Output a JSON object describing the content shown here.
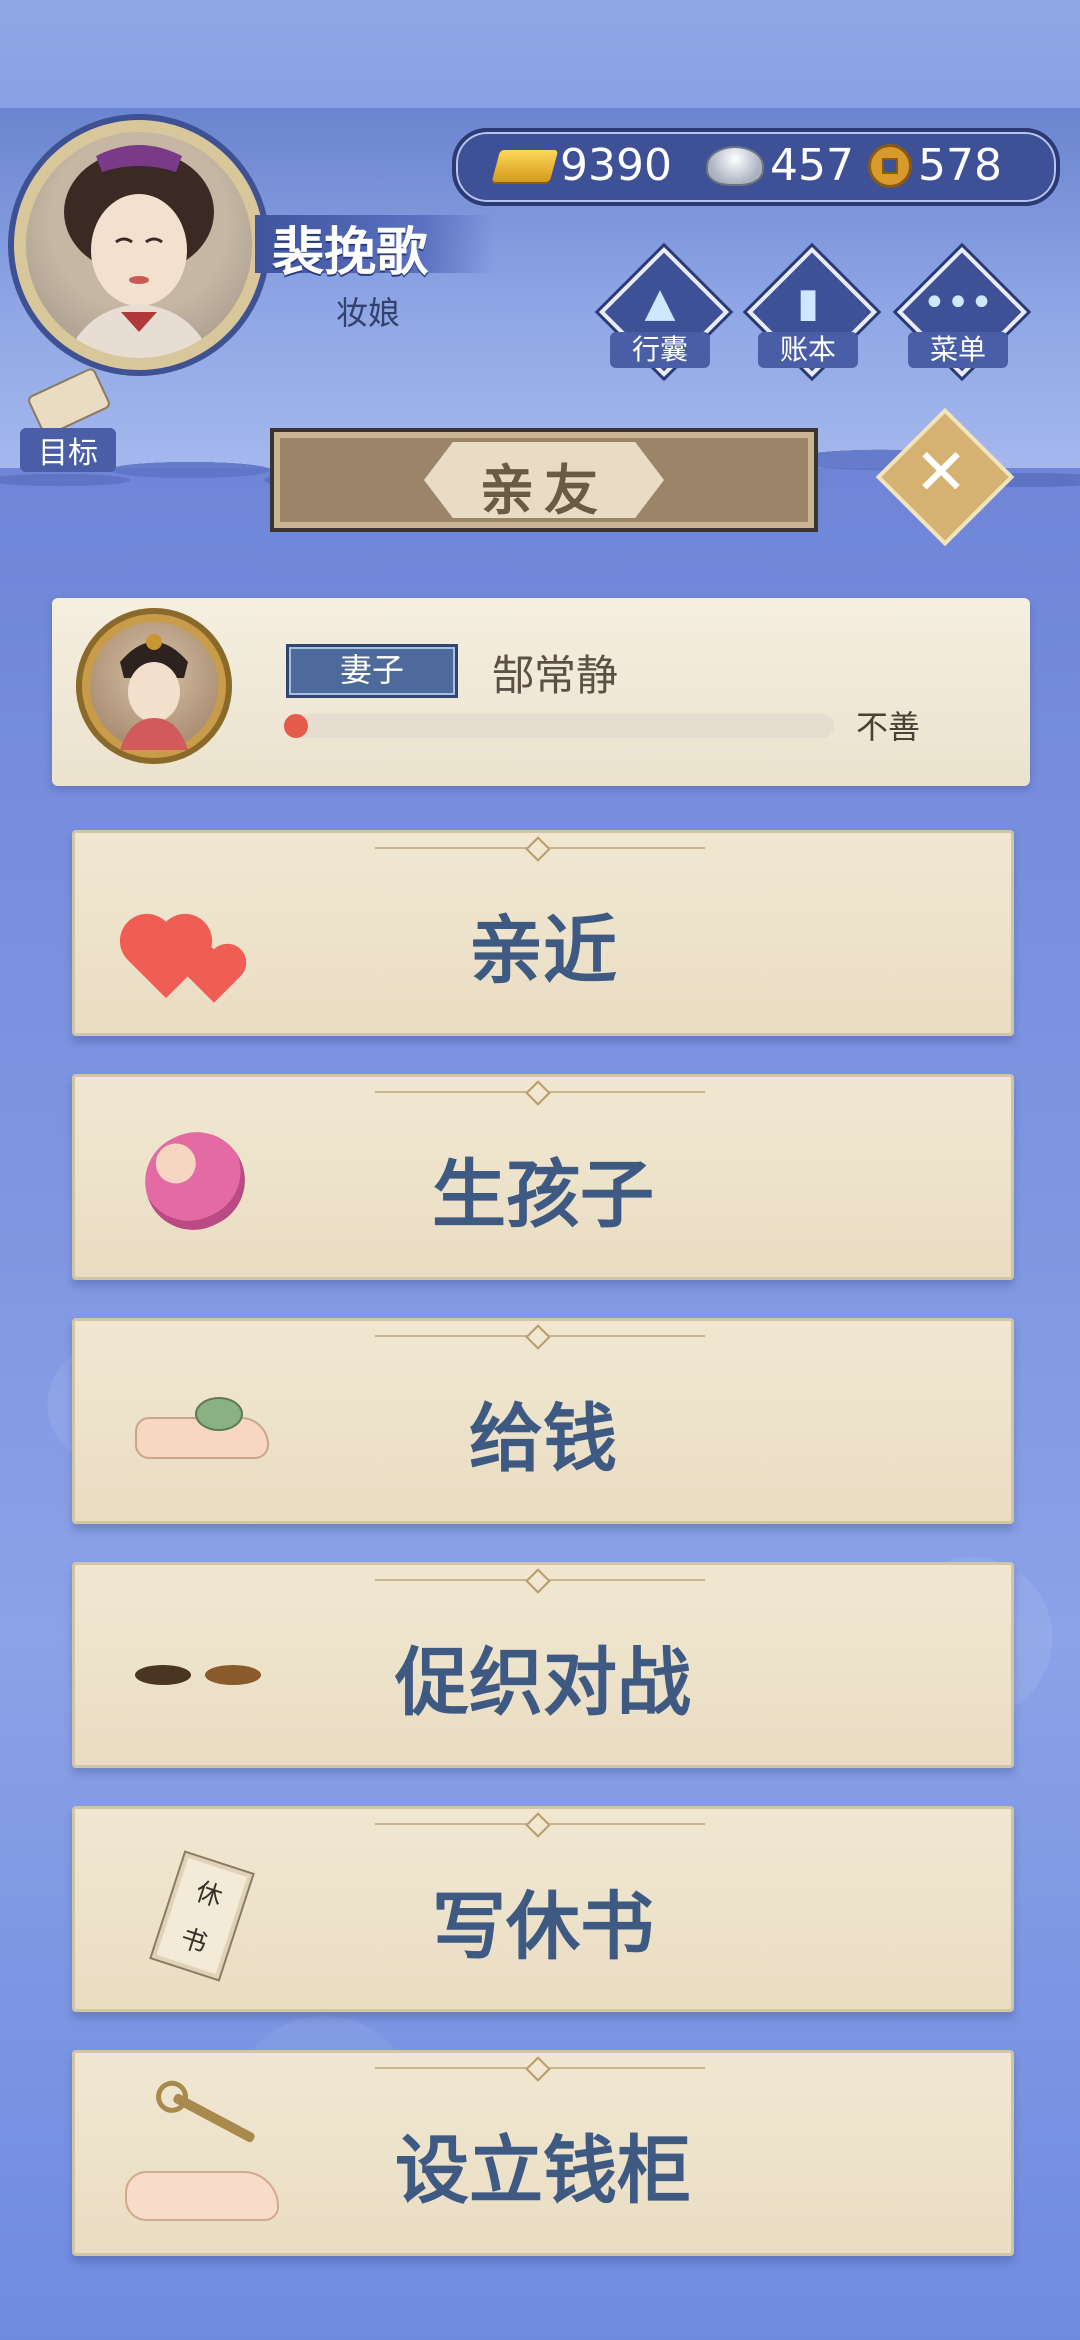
{
  "player": {
    "name": "裴挽歌",
    "title": "妆娘"
  },
  "currency": {
    "gold": "9390",
    "silver": "457",
    "copper": "578"
  },
  "menu": {
    "bag": "行囊",
    "ledger": "账本",
    "more": "菜单"
  },
  "goal_label": "目标",
  "page_title": "亲友",
  "spouse": {
    "role": "妻子",
    "name": "郜常静",
    "relation_label": "不善",
    "relation_level": 0.03
  },
  "actions": [
    {
      "label": "亲近",
      "icon": "hearts-icon"
    },
    {
      "label": "生孩子",
      "icon": "baby-icon"
    },
    {
      "label": "给钱",
      "icon": "money-hand-icon"
    },
    {
      "label": "促织对战",
      "icon": "cricket-icon"
    },
    {
      "label": "写休书",
      "icon": "divorce-letter-icon"
    },
    {
      "label": "设立钱柜",
      "icon": "key-hand-icon"
    }
  ],
  "divorce_icon_text": [
    "休",
    "书"
  ],
  "colors": {
    "accent_blue": "#3e5096",
    "card_bg": "#f1e7d1",
    "label_blue": "#3e5a82",
    "bar_red": "#e45a4b"
  }
}
